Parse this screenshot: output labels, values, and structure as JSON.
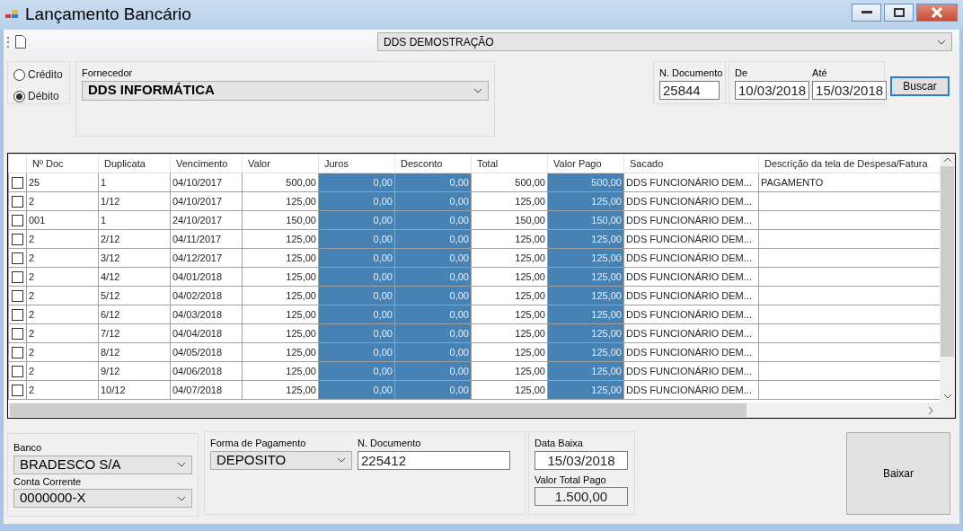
{
  "window": {
    "title": "Lançamento Bancário"
  },
  "toolbar": {
    "company": "DDS DEMOSTRAÇÃO"
  },
  "type_options": [
    {
      "label": "Crédito",
      "selected": false
    },
    {
      "label": "Débito",
      "selected": true
    }
  ],
  "fornecedor": {
    "label": "Fornecedor",
    "value": "DDS INFORMÁTICA"
  },
  "documento": {
    "label": "N. Documento",
    "value": "25844"
  },
  "periodo": {
    "from_label": "De",
    "from": "10/03/2018",
    "to_label": "Até",
    "to": "15/03/2018"
  },
  "search_button": "Buscar",
  "table": {
    "columns": [
      {
        "label": "Nº Doc",
        "kind": "text",
        "highlighted": false
      },
      {
        "label": "Duplicata",
        "kind": "text",
        "highlighted": false
      },
      {
        "label": "Vencimento",
        "kind": "text",
        "highlighted": false
      },
      {
        "label": "Valor",
        "kind": "number",
        "highlighted": false
      },
      {
        "label": "Juros",
        "kind": "number",
        "highlighted": true
      },
      {
        "label": "Desconto",
        "kind": "number",
        "highlighted": true
      },
      {
        "label": "Total",
        "kind": "number",
        "highlighted": false
      },
      {
        "label": "Valor Pago",
        "kind": "number",
        "highlighted": true
      },
      {
        "label": "Sacado",
        "kind": "text",
        "highlighted": false
      },
      {
        "label": "Descrição da tela de Despesa/Fatura",
        "kind": "text",
        "highlighted": false
      }
    ],
    "rows": [
      {
        "checked": false,
        "cells": [
          "25",
          "1",
          "04/10/2017",
          "500,00",
          "0,00",
          "0,00",
          "500,00",
          "500,00",
          "DDS FUNCIONÁRIO DEM...",
          "PAGAMENTO"
        ]
      },
      {
        "checked": false,
        "cells": [
          "2",
          "1/12",
          "04/10/2017",
          "125,00",
          "0,00",
          "0,00",
          "125,00",
          "125,00",
          "DDS FUNCIONÁRIO DEM...",
          ""
        ]
      },
      {
        "checked": false,
        "cells": [
          "001",
          "1",
          "24/10/2017",
          "150,00",
          "0,00",
          "0,00",
          "150,00",
          "150,00",
          "DDS FUNCIONÁRIO DEM...",
          ""
        ]
      },
      {
        "checked": false,
        "cells": [
          "2",
          "2/12",
          "04/11/2017",
          "125,00",
          "0,00",
          "0,00",
          "125,00",
          "125,00",
          "DDS FUNCIONÁRIO DEM...",
          ""
        ]
      },
      {
        "checked": false,
        "cells": [
          "2",
          "3/12",
          "04/12/2017",
          "125,00",
          "0,00",
          "0,00",
          "125,00",
          "125,00",
          "DDS FUNCIONÁRIO DEM...",
          ""
        ]
      },
      {
        "checked": false,
        "cells": [
          "2",
          "4/12",
          "04/01/2018",
          "125,00",
          "0,00",
          "0,00",
          "125,00",
          "125,00",
          "DDS FUNCIONÁRIO DEM...",
          ""
        ]
      },
      {
        "checked": false,
        "cells": [
          "2",
          "5/12",
          "04/02/2018",
          "125,00",
          "0,00",
          "0,00",
          "125,00",
          "125,00",
          "DDS FUNCIONÁRIO DEM...",
          ""
        ]
      },
      {
        "checked": false,
        "cells": [
          "2",
          "6/12",
          "04/03/2018",
          "125,00",
          "0,00",
          "0,00",
          "125,00",
          "125,00",
          "DDS FUNCIONÁRIO DEM...",
          ""
        ]
      },
      {
        "checked": false,
        "cells": [
          "2",
          "7/12",
          "04/04/2018",
          "125,00",
          "0,00",
          "0,00",
          "125,00",
          "125,00",
          "DDS FUNCIONÁRIO DEM...",
          ""
        ]
      },
      {
        "checked": false,
        "cells": [
          "2",
          "8/12",
          "04/05/2018",
          "125,00",
          "0,00",
          "0,00",
          "125,00",
          "125,00",
          "DDS FUNCIONÁRIO DEM...",
          ""
        ]
      },
      {
        "checked": false,
        "cells": [
          "2",
          "9/12",
          "04/06/2018",
          "125,00",
          "0,00",
          "0,00",
          "125,00",
          "125,00",
          "DDS FUNCIONÁRIO DEM...",
          ""
        ]
      },
      {
        "checked": false,
        "cells": [
          "2",
          "10/12",
          "04/07/2018",
          "125,00",
          "0,00",
          "0,00",
          "125,00",
          "125,00",
          "DDS FUNCIONÁRIO DEM...",
          ""
        ]
      }
    ]
  },
  "banco": {
    "label": "Banco",
    "value": "BRADESCO S/A",
    "conta_label": "Conta Corrente",
    "conta": "0000000-X"
  },
  "pagamento": {
    "label": "Forma de Pagamento",
    "value": "DEPOSITO",
    "doc_label": "N. Documento",
    "doc": "225412"
  },
  "baixa": {
    "date_label": "Data Baixa",
    "date": "15/03/2018",
    "total_label": "Valor Total Pago",
    "total": "1.500,00"
  },
  "action_button": "Baixar"
}
